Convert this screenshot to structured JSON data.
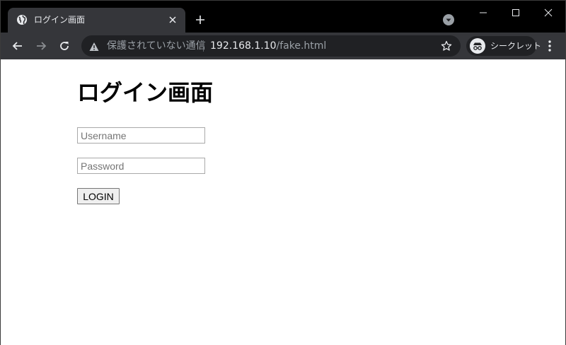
{
  "browser": {
    "tab": {
      "title": "ログイン画面",
      "favicon_icon": "globe-icon",
      "close_icon": "close-icon"
    },
    "new_tab_icon": "plus-icon",
    "tab_search_icon": "chevron-down-circle-icon",
    "window_controls": {
      "minimize_icon": "minimize-icon",
      "maximize_icon": "maximize-icon",
      "close_icon": "close-icon"
    },
    "toolbar": {
      "back_icon": "arrow-left-icon",
      "forward_icon": "arrow-right-icon",
      "reload_icon": "reload-icon",
      "omnibox": {
        "security_icon": "warning-icon",
        "security_text": "保護されていない通信",
        "url_host": "192.168.1.10",
        "url_path": "/fake.html",
        "bookmark_icon": "star-icon"
      },
      "incognito": {
        "icon": "incognito-icon",
        "label": "シークレット"
      },
      "menu_icon": "more-vertical-icon"
    }
  },
  "colors": {
    "tabstrip_bg": "#000000",
    "toolbar_bg": "#35363a",
    "omnibox_bg": "#202124",
    "text_light": "#e8eaed",
    "text_dim": "#9aa0a6"
  },
  "page": {
    "title": "ログイン画面",
    "username": {
      "placeholder": "Username",
      "value": ""
    },
    "password": {
      "placeholder": "Password",
      "value": ""
    },
    "login_label": "LOGIN"
  }
}
